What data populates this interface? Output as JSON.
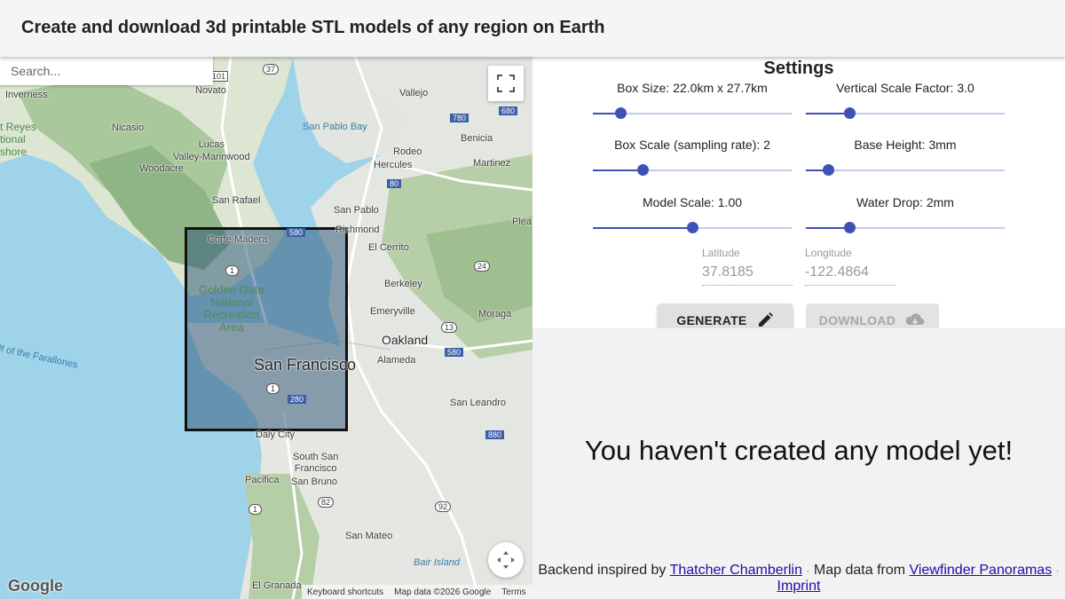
{
  "header": {
    "title": "Create and download 3d printable STL models of any region on Earth"
  },
  "map": {
    "search_placeholder": "Search...",
    "fullscreen_icon": "fullscreen-icon",
    "pan_icon": "pan-arrows-icon",
    "google_logo": "Google",
    "attribution": {
      "shortcuts": "Keyboard shortcuts",
      "map_data": "Map data ©2026 Google",
      "terms": "Terms"
    },
    "labels": {
      "inverness": "Inverness",
      "novato": "Novato",
      "vallejo": "Vallejo",
      "nicasio": "Nicasio",
      "point_reyes": "t Reyes\ntional\nshore",
      "san_pablo_bay": "San Pablo Bay",
      "benicia": "Benicia",
      "lucas_valley": "Lucas\nValley-Marinwood",
      "rodeo": "Rodeo",
      "hercules": "Hercules",
      "martinez": "Martinez",
      "woodacre": "Woodacre",
      "san_rafael": "San Rafael",
      "san_pablo": "San Pablo",
      "pleasant": "Plea",
      "corte_madera": "Corte Madera",
      "richmond": "Richmond",
      "el_cerrito": "El Cerrito",
      "golden_gate": "Golden Gate\nNational\nRecreation\nArea",
      "berkeley": "Berkeley",
      "emeryville": "Emeryville",
      "moraga": "Moraga",
      "oakland": "Oakland",
      "farallones": "lf of the Farallones",
      "san_francisco": "San Francisco",
      "alameda": "Alameda",
      "san_leandro": "San Leandro",
      "daly_city": "Daly City",
      "south_sf": "South San\nFrancisco",
      "pacifica": "Pacifica",
      "san_bruno": "San Bruno",
      "san_mateo": "San Mateo",
      "bair_island": "Bair Island",
      "el_granada": "El Granada",
      "shield_37": "37",
      "shield_101": "101",
      "shield_780": "780",
      "shield_680": "680",
      "shield_80": "80",
      "shield_580a": "580",
      "shield_1a": "1",
      "shield_24": "24",
      "shield_13": "13",
      "shield_580b": "580",
      "shield_1b": "1",
      "shield_280": "280",
      "shield_880": "880",
      "shield_82": "82",
      "shield_92": "92",
      "shield_1c": "1"
    }
  },
  "settings": {
    "title": "Settings",
    "sliders": [
      {
        "label": "Box Size: 22.0km x 27.7km",
        "fraction": 0.14
      },
      {
        "label": "Vertical Scale Factor: 3.0",
        "fraction": 0.22
      },
      {
        "label": "Box Scale (sampling rate): 2",
        "fraction": 0.25
      },
      {
        "label": "Base Height: 3mm",
        "fraction": 0.11
      },
      {
        "label": "Model Scale: 1.00",
        "fraction": 0.5
      },
      {
        "label": "Water Drop: 2mm",
        "fraction": 0.22
      }
    ],
    "latitude": {
      "label": "Latitude",
      "value": "37.8185"
    },
    "longitude": {
      "label": "Longitude",
      "value": "-122.4864"
    },
    "generate_label": "GENERATE",
    "generate_icon": "pencil-icon",
    "download_label": "DOWNLOAD",
    "download_icon": "cloud-download-icon",
    "accent_color": "#3f51b5"
  },
  "result": {
    "empty_message": "You haven't created any model yet!",
    "footer": {
      "backend_prefix": "Backend inspired by",
      "backend_link": "Thatcher Chamberlin",
      "sep1": "·",
      "mapdata_prefix": "Map data from",
      "mapdata_link": "Viewfinder Panoramas",
      "sep2": "·",
      "imprint_link": "Imprint"
    }
  }
}
